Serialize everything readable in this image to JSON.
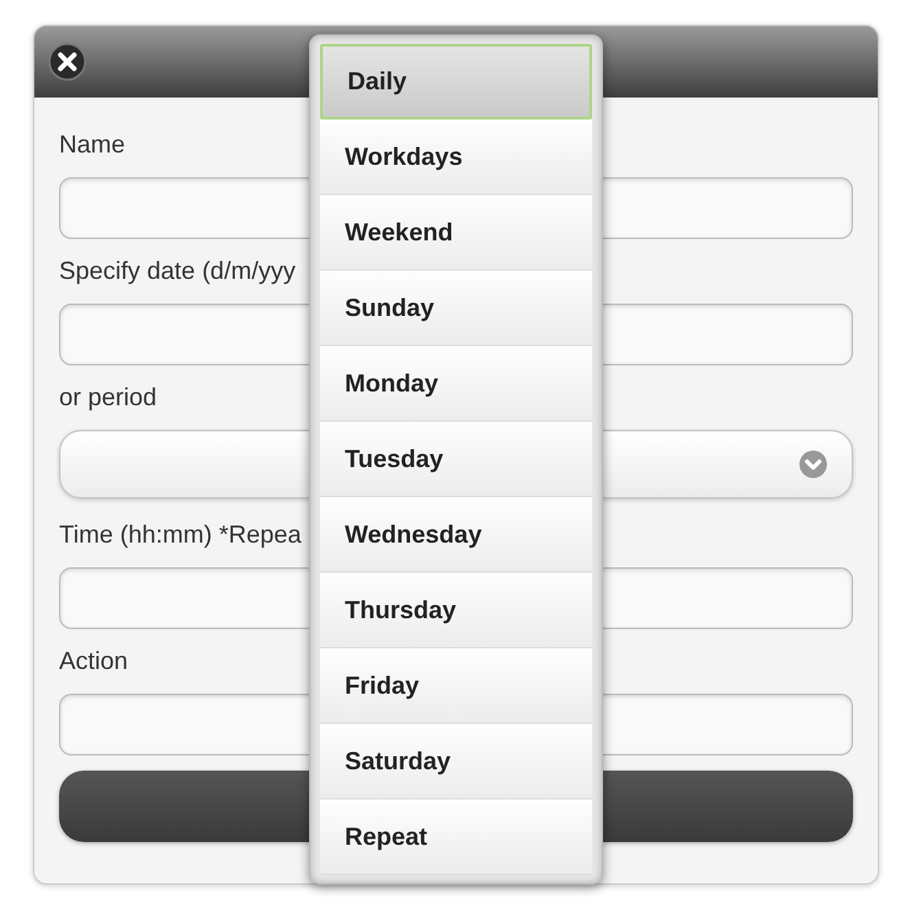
{
  "dialog": {
    "fields": [
      {
        "label": "Name",
        "kind": "text"
      },
      {
        "label": "Specify date (d/m/yyy",
        "kind": "text"
      },
      {
        "label": "or period",
        "kind": "select"
      },
      {
        "label": "Time (hh:mm) *Repea",
        "kind": "text"
      },
      {
        "label": "Action",
        "kind": "text"
      }
    ]
  },
  "menu": {
    "items": [
      {
        "label": "Daily",
        "selected": true
      },
      {
        "label": "Workdays",
        "selected": false
      },
      {
        "label": "Weekend",
        "selected": false
      },
      {
        "label": "Sunday",
        "selected": false
      },
      {
        "label": "Monday",
        "selected": false
      },
      {
        "label": "Tuesday",
        "selected": false
      },
      {
        "label": "Wednesday",
        "selected": false
      },
      {
        "label": "Thursday",
        "selected": false
      },
      {
        "label": "Friday",
        "selected": false
      },
      {
        "label": "Saturday",
        "selected": false
      },
      {
        "label": "Repeat",
        "selected": false
      }
    ]
  }
}
